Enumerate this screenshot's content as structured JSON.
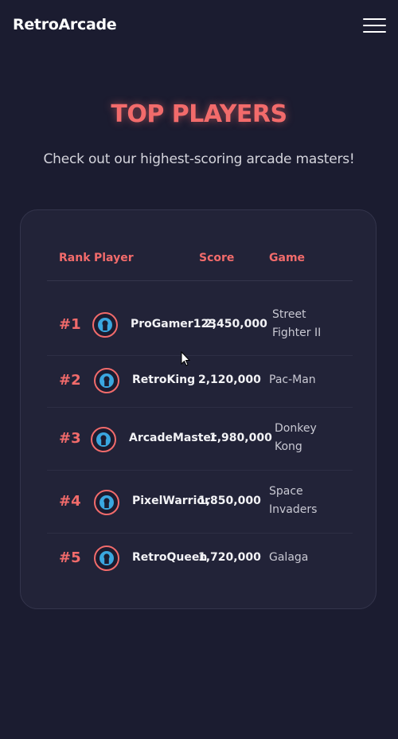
{
  "app": {
    "logo": "RetroArcade",
    "menu_icon": "hamburger-menu-icon"
  },
  "hero": {
    "title": "TOP PLAYERS",
    "subtitle": "Check out our highest-scoring arcade masters!"
  },
  "leaderboard": {
    "headers": {
      "rank": "Rank",
      "player": "Player",
      "score": "Score",
      "game": "Game"
    },
    "rows": [
      {
        "rank": "#1",
        "player": "ProGamer123",
        "score": "2,450,000",
        "game": "Street Fighter II",
        "avatar_icon": "user-avatar-icon"
      },
      {
        "rank": "#2",
        "player": "RetroKing",
        "score": "2,120,000",
        "game": "Pac-Man",
        "avatar_icon": "user-avatar-icon"
      },
      {
        "rank": "#3",
        "player": "ArcadeMaster",
        "score": "1,980,000",
        "game": "Donkey Kong",
        "avatar_icon": "user-avatar-icon"
      },
      {
        "rank": "#4",
        "player": "PixelWarrior",
        "score": "1,850,000",
        "game": "Space Invaders",
        "avatar_icon": "user-avatar-icon"
      },
      {
        "rank": "#5",
        "player": "RetroQueen",
        "score": "1,720,000",
        "game": "Galaga",
        "avatar_icon": "user-avatar-icon"
      }
    ]
  },
  "colors": {
    "background": "#1b1c30",
    "card": "#222338",
    "accent": "#f26b6b",
    "avatar_icon": "#3aa7e0"
  }
}
